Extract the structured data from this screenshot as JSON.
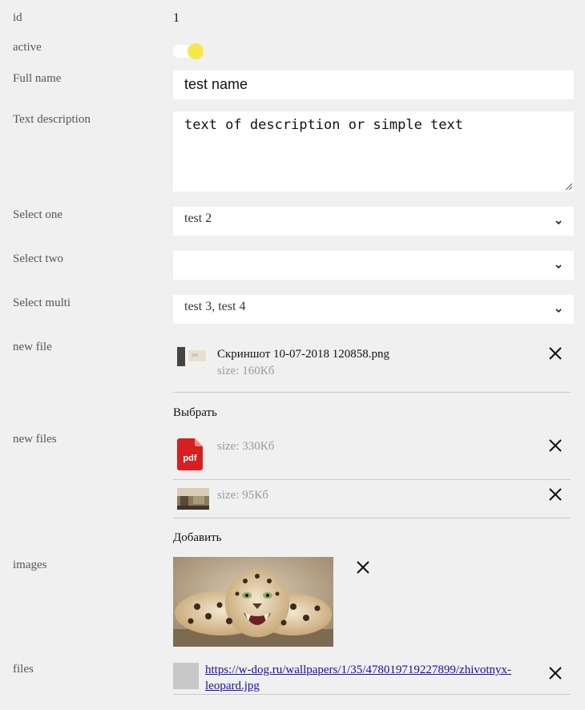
{
  "fields": {
    "id": {
      "label": "id",
      "value": "1"
    },
    "active": {
      "label": "active",
      "checked": true,
      "knob_color": "#f5e94a"
    },
    "full_name": {
      "label": "Full name",
      "value": "test name"
    },
    "text_description": {
      "label": "Text description",
      "value": "text of description or simple text"
    },
    "select_one": {
      "label": "Select one",
      "value": "test 2"
    },
    "select_two": {
      "label": "Select two",
      "value": ""
    },
    "select_multi": {
      "label": "Select multi",
      "value": "test 3, test 4"
    },
    "new_file": {
      "label": "new file",
      "file_name": "Скриншот 10-07-2018 120858.png",
      "file_size": "size: 160Кб",
      "choose_label": "Выбрать"
    },
    "new_files": {
      "label": "new files",
      "items": [
        {
          "icon": "pdf-icon",
          "icon_text": "pdf",
          "file_size": "size: 330Кб"
        },
        {
          "icon": "image-thumbnail",
          "file_size": "size: 95Кб"
        }
      ],
      "add_label": "Добавить"
    },
    "images": {
      "label": "images",
      "image": "leopard-photo"
    },
    "files": {
      "label": "files",
      "link_text_line1": "https://w-dog.ru/wallpapers/1/35/478019719227899/zhivotnyx-",
      "link_text_line2": "leopard.jpg"
    }
  },
  "colors": {
    "background": "#f0f0f0",
    "pdf_red": "#d61f1f",
    "link": "#1a0dab"
  }
}
